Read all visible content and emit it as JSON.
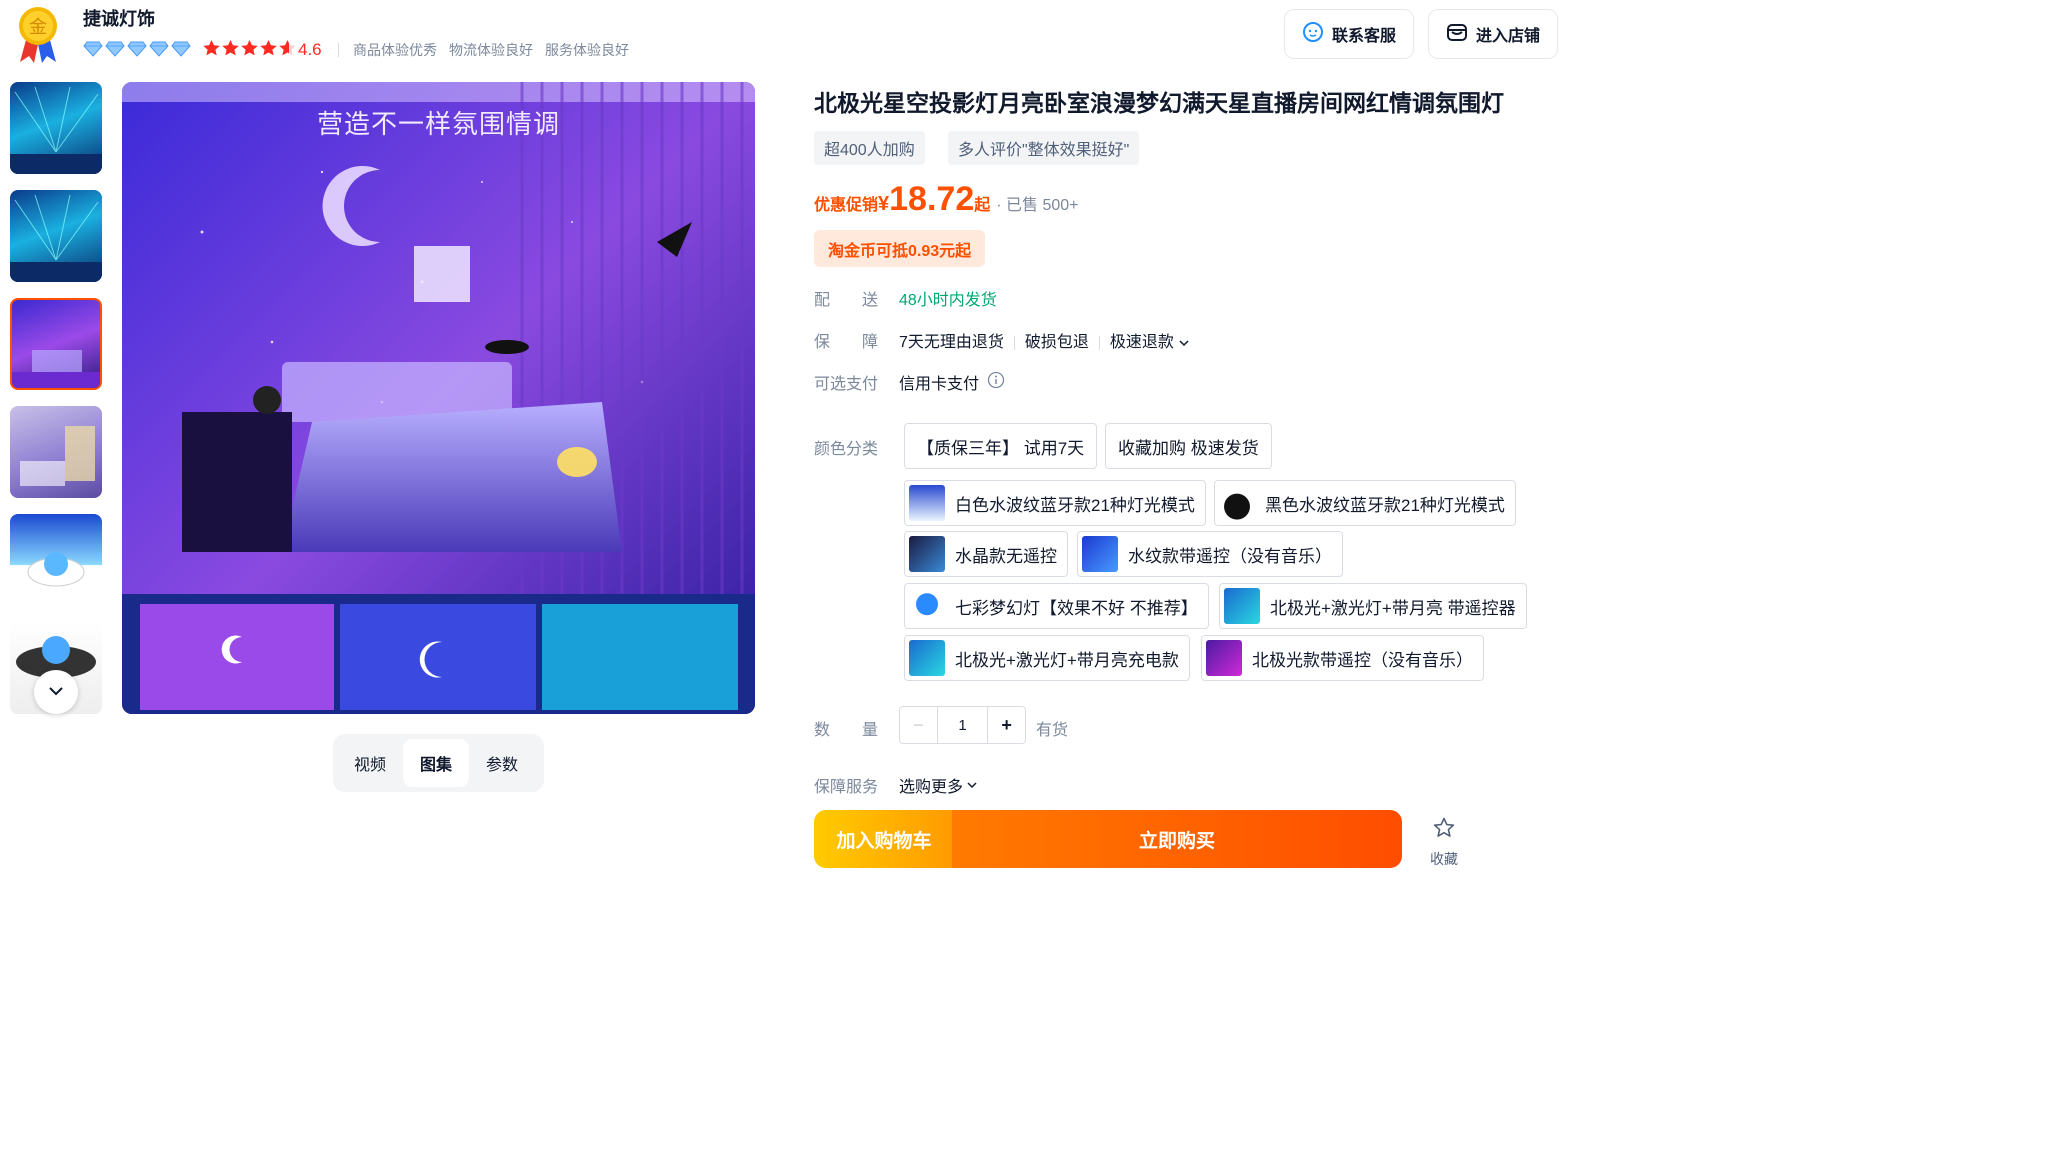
{
  "shop": {
    "badge_text": "金",
    "name": "捷诚灯饰",
    "diamond_count": 5,
    "star_rating": 4.6,
    "rating_text": "4.6",
    "tags": [
      "商品体验优秀",
      "物流体验良好",
      "服务体验良好"
    ],
    "service_button": "联系客服",
    "store_button": "进入店铺"
  },
  "gallery": {
    "thumbnail_count": 6,
    "selected_index": 2,
    "main_caption": "营造不一样氛围情调",
    "tabs": [
      "视频",
      "图集",
      "参数"
    ],
    "active_tab": "图集"
  },
  "product": {
    "title": "北极光星空投影灯月亮卧室浪漫梦幻满天星直播房间网红情调氛围灯",
    "tags": [
      "超400人加购",
      "多人评价\"整体效果挺好\""
    ],
    "price_label": "优惠促销",
    "price_symbol": "¥",
    "price": "18.72",
    "price_suffix": "起",
    "sold": "· 已售 500+",
    "coin_text": "淘金币可抵0.93元起"
  },
  "delivery": {
    "label": "配　　送",
    "value": "48小时内发货"
  },
  "guarantee": {
    "label": "保　　障",
    "items": [
      "7天无理由退货",
      "破损包退",
      "极速退款"
    ]
  },
  "payment": {
    "label": "可选支付",
    "value": "信用卡支付"
  },
  "color": {
    "label": "颜色分类",
    "options": [
      {
        "text": "【质保三年】 试用7天",
        "selected": false
      },
      {
        "text": "收藏加购 极速发货",
        "selected": false
      },
      {
        "text": "白色水波纹蓝牙款21种灯光模式",
        "selected": false
      },
      {
        "text": "黑色水波纹蓝牙款21种灯光模式",
        "selected": false
      },
      {
        "text": "水晶款无遥控",
        "selected": false
      },
      {
        "text": "水纹款带遥控（没有音乐）",
        "selected": false
      },
      {
        "text": "七彩梦幻灯【效果不好 不推荐】",
        "selected": false
      },
      {
        "text": "北极光+激光灯+带月亮 带遥控器",
        "selected": false
      },
      {
        "text": "北极光+激光灯+带月亮充电款",
        "selected": false
      },
      {
        "text": "北极光款带遥控（没有音乐）",
        "selected": false
      }
    ]
  },
  "quantity": {
    "label": "数　　量",
    "minus": "−",
    "value": "1",
    "plus": "+",
    "stock": "有货"
  },
  "protection": {
    "label": "保障服务",
    "value": "选购更多"
  },
  "actions": {
    "cart": "加入购物车",
    "buy": "立即购买",
    "favorite": "收藏"
  },
  "colors": {
    "accent": "#ff5000",
    "cart_start": "#ffcb00",
    "buy_end": "#ff4d00",
    "delivery_green": "#00a870"
  }
}
